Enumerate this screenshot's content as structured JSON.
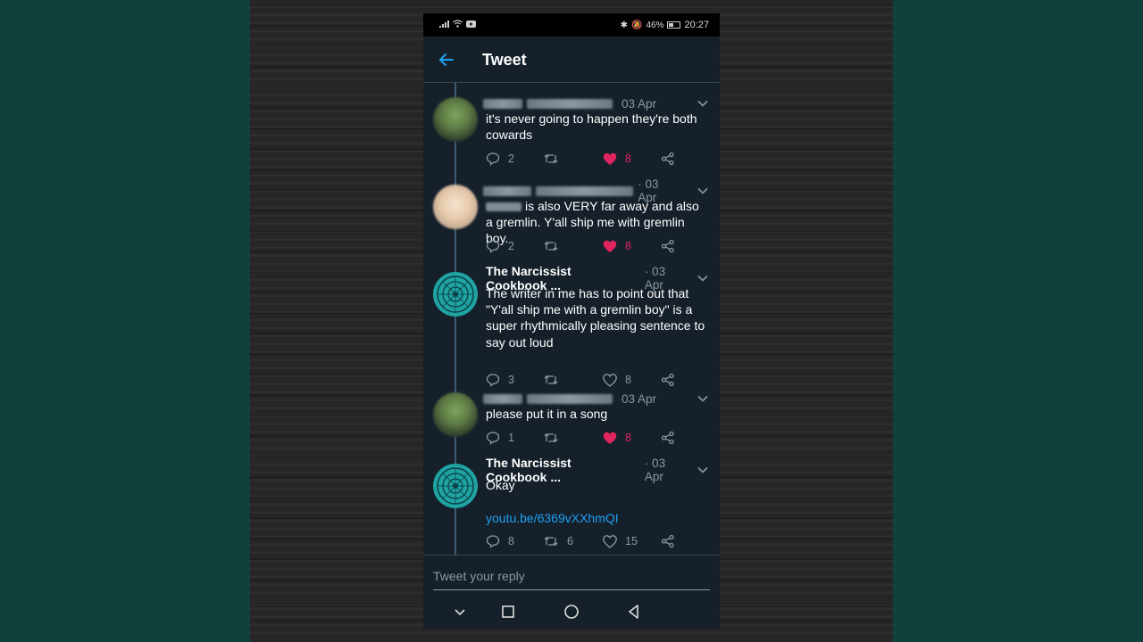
{
  "status_bar": {
    "battery": "46%",
    "time": "20:27"
  },
  "header": {
    "title": "Tweet"
  },
  "tweets": [
    {
      "name": "",
      "date": "03 Apr",
      "text": "it's never going to happen they're both cowards",
      "replies": "2",
      "retweets": "",
      "likes": "8",
      "liked": true
    },
    {
      "name": "",
      "date": "· 03 Apr",
      "text": "is also VERY far away and also a gremlin. Y'all ship me with gremlin boy.",
      "replies": "2",
      "retweets": "",
      "likes": "8",
      "liked": true
    },
    {
      "name": "The Narcissist Cookbook ...",
      "date": "· 03 Apr",
      "text": "The writer in me has to point out that \"Y'all ship me with a gremlin boy\" is a super rhythmically pleasing sentence to say out loud",
      "replies": "3",
      "retweets": "",
      "likes": "8",
      "liked": false
    },
    {
      "name": "",
      "date": "03 Apr",
      "text": "please put it in a song",
      "replies": "1",
      "retweets": "",
      "likes": "8",
      "liked": true
    },
    {
      "name": "The Narcissist Cookbook ...",
      "date": "· 03 Apr",
      "text": "Okay",
      "link": "youtu.be/6369vXXhmQI",
      "replies": "8",
      "retweets": "6",
      "likes": "15",
      "liked": false
    }
  ],
  "reply_box": {
    "placeholder": "Tweet your reply"
  },
  "icons": {
    "reply": "reply-icon",
    "retweet": "retweet-icon",
    "like": "heart-icon",
    "share": "share-icon"
  },
  "colors": {
    "background": "#15202b",
    "accent": "#1da1f2",
    "like": "#e0245e",
    "muted": "#8899a6"
  }
}
